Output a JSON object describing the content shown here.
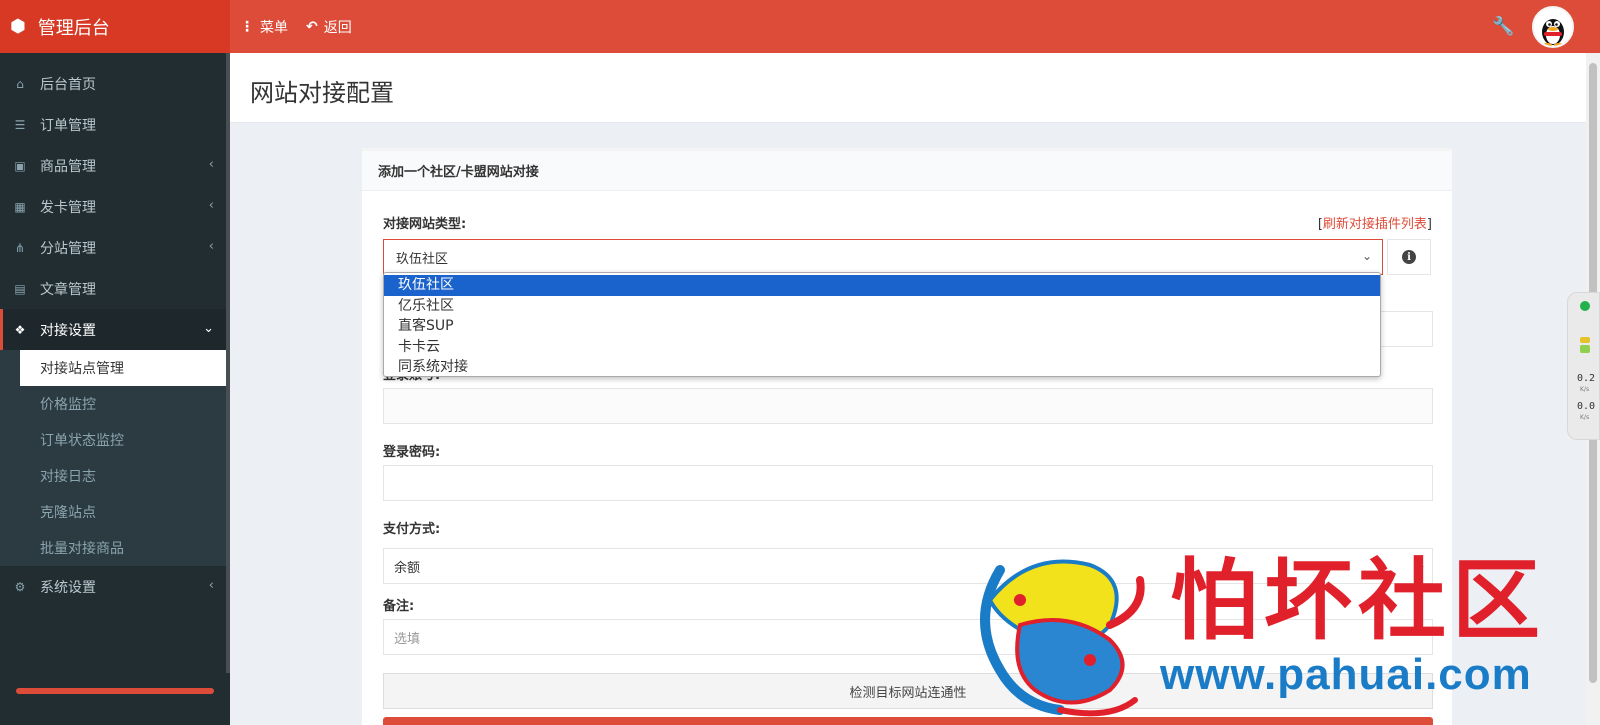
{
  "header": {
    "brand": "管理后台",
    "menu_label": "菜单",
    "back_label": "返回"
  },
  "sidebar": {
    "items": [
      {
        "label": "后台首页",
        "icon": "home-icon",
        "glyph": "⌂"
      },
      {
        "label": "订单管理",
        "icon": "list-icon",
        "glyph": "☰"
      },
      {
        "label": "商品管理",
        "icon": "cart-icon",
        "glyph": "▣"
      },
      {
        "label": "发卡管理",
        "icon": "grid-icon",
        "glyph": "▦"
      },
      {
        "label": "分站管理",
        "icon": "sitemap-icon",
        "glyph": "⋔"
      },
      {
        "label": "文章管理",
        "icon": "book-icon",
        "glyph": "▤"
      }
    ],
    "active_item": {
      "label": "对接设置",
      "icon": "cubes-icon",
      "glyph": "❖"
    },
    "sub_items": [
      "对接站点管理",
      "价格监控",
      "订单状态监控",
      "对接日志",
      "克隆站点",
      "批量对接商品"
    ],
    "after_items": [
      {
        "label": "系统设置",
        "icon": "gear-icon",
        "glyph": "⚙"
      }
    ]
  },
  "page": {
    "title": "网站对接配置"
  },
  "form": {
    "box_title": "添加一个社区/卡盟网站对接",
    "type_label": "对接网站类型:",
    "refresh_open": "[",
    "refresh_link": "刷新对接插件列表",
    "refresh_close": "]",
    "selected_type": "玖伍社区",
    "type_options": [
      "玖伍社区",
      "亿乐社区",
      "直客SUP",
      "卡卡云",
      "同系统对接"
    ],
    "account_label": "登录账号:",
    "password_label": "登录密码:",
    "payment_label": "支付方式:",
    "payment_value": "余额",
    "remark_label": "备注:",
    "remark_placeholder": "选填",
    "test_button": "检测目标网站连通性"
  },
  "widget": {
    "upload": "0.2",
    "upload_unit": "K/s",
    "download": "0.0",
    "download_unit": "K/s"
  },
  "watermark": {
    "name": "怕坏社区",
    "url": "www.pahuai.com"
  },
  "colors": {
    "header": "#dd4b39",
    "sidebar": "#222d32",
    "accent": "#dd4b39",
    "dropdown_selected": "#1a62cc"
  }
}
